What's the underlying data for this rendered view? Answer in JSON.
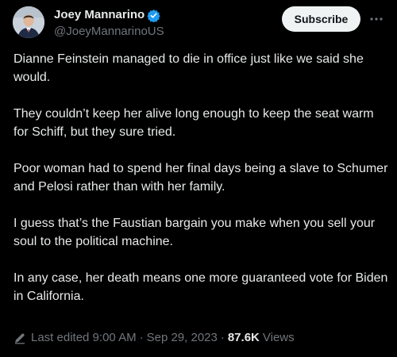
{
  "author": {
    "display_name": "Joey Mannarino",
    "handle": "@JoeyMannarinoUS",
    "verified": true,
    "avatar_icon": "profile-photo"
  },
  "actions": {
    "subscribe_label": "Subscribe",
    "more_icon": "more-horizontal-icon"
  },
  "tweet": {
    "paragraphs": [
      "Dianne Feinstein managed to die in office just like we said she would.",
      "They couldn’t keep her alive long enough to keep the seat warm for Schiff, but they sure tried.",
      "Poor woman had to spend her final days being a slave to Schumer and Pelosi rather than with her family.",
      "I guess that’s the Faustian bargain you make when you sell your soul to the political machine.",
      "In any case, her death means one more guaranteed vote for Biden in California."
    ]
  },
  "meta": {
    "edit_icon": "pencil-icon",
    "edited_label": "Last edited 9:00 AM",
    "separator": "·",
    "date": "Sep 29, 2023",
    "views_count": "87.6K",
    "views_label": "Views"
  },
  "colors": {
    "background": "#000000",
    "text": "#e7e9ea",
    "secondary": "#71767b",
    "verified_blue": "#1d9bf0",
    "button_bg": "#eff3f4"
  }
}
